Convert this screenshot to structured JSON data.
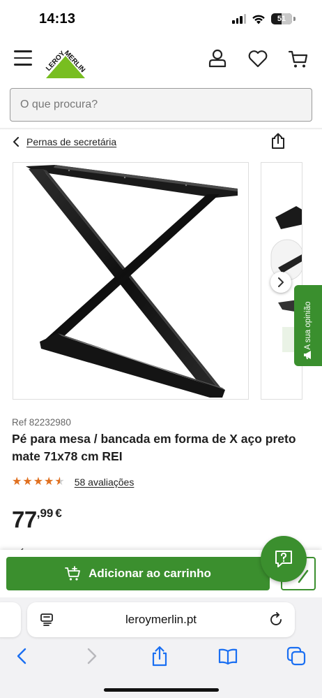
{
  "status_bar": {
    "time": "14:13",
    "battery": "51"
  },
  "header": {
    "logo_alt": "LEROY MERLIN",
    "logo_line1": "LEROY",
    "logo_line2": "MERLIN",
    "icons": [
      "menu-icon",
      "account-icon",
      "heart-icon",
      "cart-icon"
    ]
  },
  "search": {
    "placeholder": "O que procura?"
  },
  "breadcrumb": {
    "label": "Pernas de secretária"
  },
  "gallery": {
    "next_icon": "chevron-right-icon",
    "feedback_label": "A sua opinião"
  },
  "product": {
    "ref": "Ref 82232980",
    "title": "Pé para mesa / bancada em forma de X aço preto mate 71x78 cm REI",
    "rating": 4.5,
    "reviews_label": "58 avaliações",
    "price_int": "77",
    "price_dec": ",99",
    "currency": "€"
  },
  "cart": {
    "add_label": "Adicionar ao carrinho"
  },
  "browser": {
    "url": "leroymerlin.pt"
  },
  "colors": {
    "brand_green": "#3b8f2e",
    "logo_green": "#78be20",
    "star_orange": "#e07020",
    "ios_blue": "#1a6ff2"
  }
}
